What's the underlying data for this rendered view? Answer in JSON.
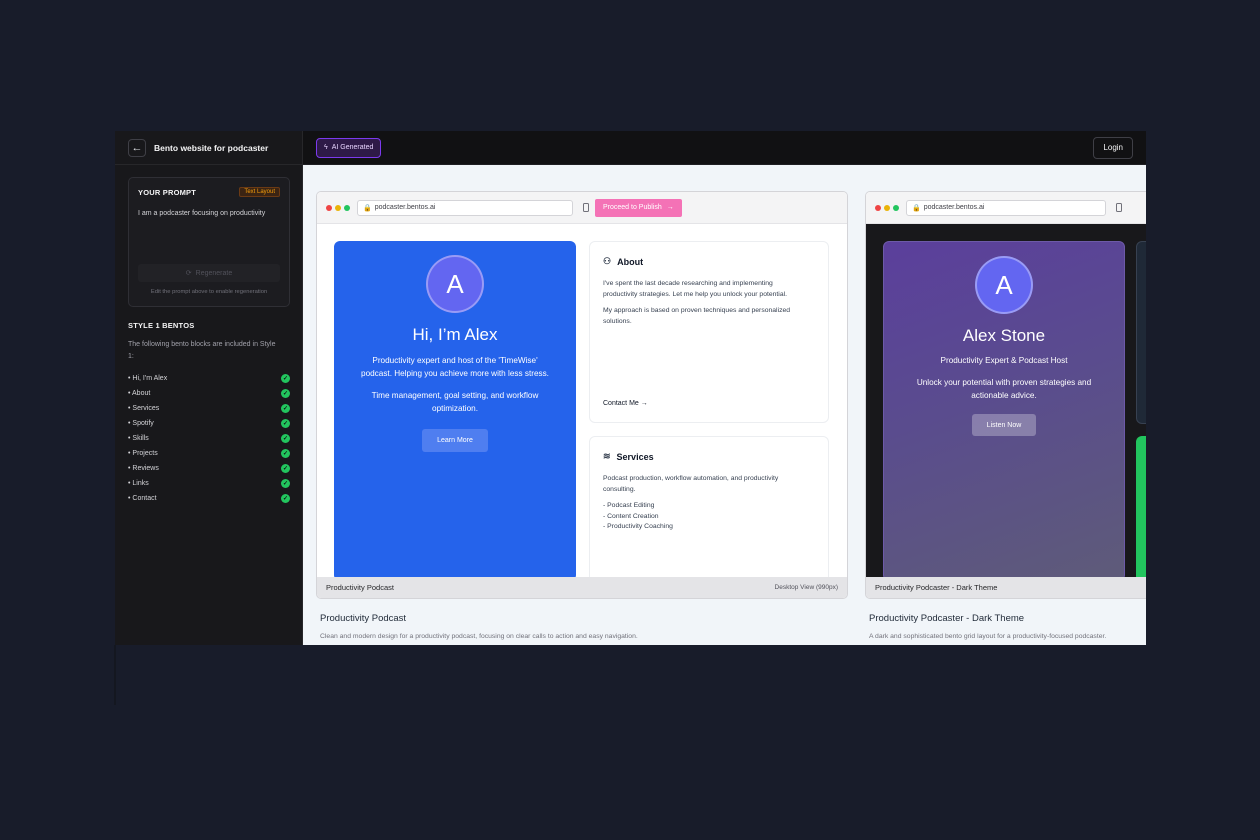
{
  "sidebar": {
    "title": "Bento website for podcaster",
    "prompt_label": "YOUR PROMPT",
    "layout_badge": "Text Layout",
    "prompt_text": "I am a podcaster focusing on productivity",
    "regenerate_label": "Regenerate",
    "regenerate_hint": "Edit the prompt above to enable regeneration",
    "style_title": "STYLE 1 BENTOS",
    "style_desc": "The following bento blocks are included in Style 1:",
    "items": [
      "Hi, I'm Alex",
      "About",
      "Services",
      "Spotify",
      "Skills",
      "Projects",
      "Reviews",
      "Links",
      "Contact"
    ]
  },
  "topbar": {
    "ai_badge": "AI Generated",
    "login_label": "Login"
  },
  "preview_a": {
    "url": "podcaster.bentos.ai",
    "publish_label": "Proceed to Publish",
    "avatar_letter": "A",
    "name": "Hi, I’m Alex",
    "bio": "Productivity expert and host of the 'TimeWise' podcast. Helping you achieve more with less stress.",
    "sub": "Time management, goal setting, and workflow optimization.",
    "learn_label": "Learn More",
    "about_title": "About",
    "about_p1": "I've spent the last decade researching and implementing productivity strategies. Let me help you unlock your potential.",
    "about_p2": "My approach is based on proven techniques and personalized solutions.",
    "contact_label": "Contact Me →",
    "services_title": "Services",
    "services_p1": "Podcast production, workflow automation, and productivity consulting.",
    "services_list": [
      "- Podcast Editing",
      "- Content Creation",
      "- Productivity Coaching"
    ],
    "footer_name": "Productivity Podcast",
    "footer_view": "Desktop View (990px)",
    "caption_title": "Productivity Podcast",
    "caption_desc": "Clean and modern design for a productivity podcast, focusing on clear calls to action and easy navigation."
  },
  "preview_b": {
    "url": "podcaster.bentos.ai",
    "avatar_letter": "A",
    "name": "Alex Stone",
    "role": "Productivity Expert & Podcast Host",
    "desc": "Unlock your potential with proven strategies and actionable advice.",
    "listen_label": "Listen Now",
    "footer_name": "Productivity Podcaster - Dark Theme",
    "caption_title": "Productivity Podcaster - Dark Theme",
    "caption_desc": "A dark and sophisticated bento grid layout for a productivity-focused podcaster."
  },
  "colors": {
    "accent_blue": "#2563eb",
    "publish_pink": "#f472b6",
    "check_green": "#22c55e",
    "ai_purple": "#7c3aed"
  }
}
